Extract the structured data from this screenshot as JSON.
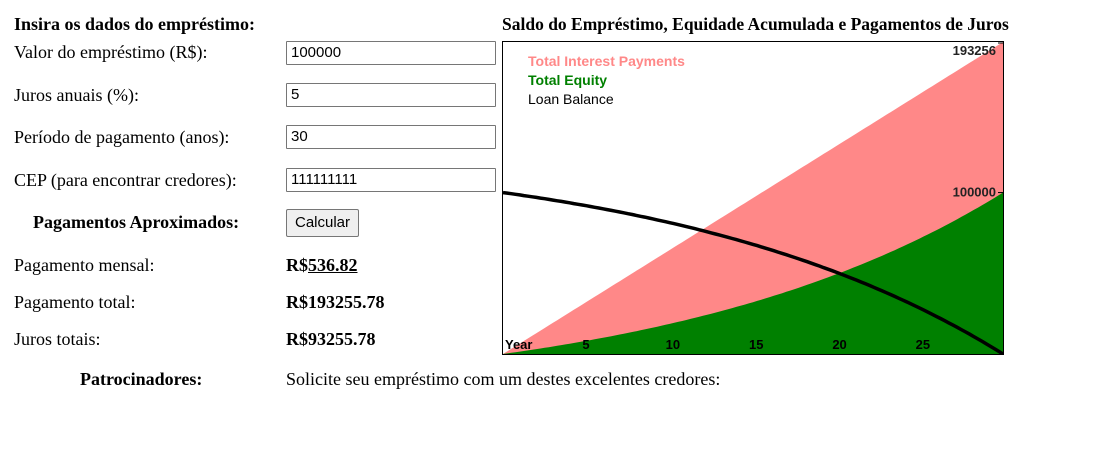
{
  "form": {
    "heading": "Insira os dados do empréstimo:",
    "loan_amount_label": "Valor do empréstimo (R$):",
    "loan_amount_value": "100000",
    "annual_rate_label": "Juros anuais (%):",
    "annual_rate_value": "5",
    "period_label": "Período de pagamento (anos):",
    "period_value": "30",
    "zip_label": "CEP (para encontrar credores):",
    "zip_value": "111111111",
    "approx_payments_label": "Pagamentos Aproximados:",
    "calculate_button": "Calcular"
  },
  "results": {
    "monthly_label": "Pagamento mensal:",
    "monthly_currency": "R$",
    "monthly_value": "536.82",
    "total_label": "Pagamento total:",
    "total_value": "R$193255.78",
    "interest_label": "Juros totais:",
    "interest_value": "R$93255.78"
  },
  "sponsors": {
    "label": "Patrocinadores:",
    "text": "Solicite seu empréstimo com um destes excelentes credores:"
  },
  "chart_title": "Saldo do Empréstimo, Equidade Acumulada e Pagamentos de Juros",
  "chart_data": {
    "type": "area",
    "title": "Saldo do Empréstimo, Equidade Acumulada e Pagamentos de Juros",
    "xlabel": "Year",
    "x_range": [
      0,
      30
    ],
    "y_range": [
      0,
      193256
    ],
    "x_ticks": [
      "Year",
      "5",
      "10",
      "15",
      "20",
      "25"
    ],
    "y_tick_labels": [
      {
        "value": 193256,
        "label": "193256"
      },
      {
        "value": 100000,
        "label": "100000"
      }
    ],
    "legend": [
      "Total Interest Payments",
      "Total Equity",
      "Loan Balance"
    ],
    "legend_position": "top-left",
    "principal": 100000,
    "annual_rate_percent": 5,
    "years": 30,
    "series": [
      {
        "name": "Total Interest Payments",
        "color": "#ff8888"
      },
      {
        "name": "Total Equity",
        "color": "#008000"
      },
      {
        "name": "Loan Balance",
        "color": "#000000"
      }
    ]
  }
}
